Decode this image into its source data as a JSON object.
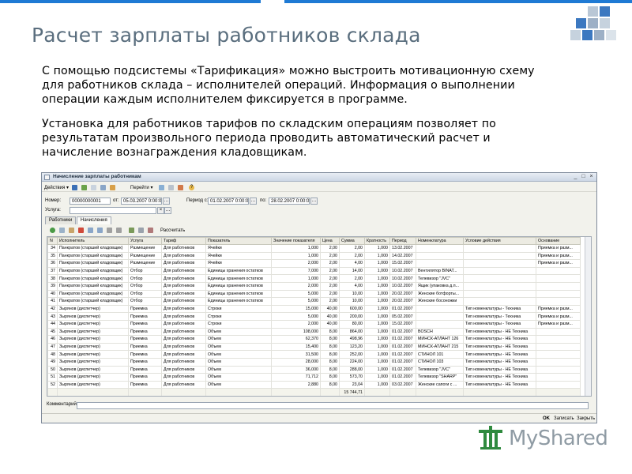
{
  "slide": {
    "title": "Расчет зарплаты работников склада",
    "paragraph1": "С помощью подсистемы «Тарификация» можно выстроить мотивационную схему для работников склада – исполнителей операций. Информация о выполнении операции каждым исполнителем фиксируется в программе.",
    "paragraph2": "Установка для работников тарифов по складским операциям позволяет по результатам произвольного периода проводить автоматический расчет и начисление вознаграждения кладовщикам."
  },
  "window": {
    "title": "Начисление зарплаты работникам",
    "menu": {
      "actions": "Действия ▾",
      "goto": "Перейти ▾",
      "help_glyph": "?"
    },
    "form": {
      "number_label": "Номер:",
      "number_value": "00000000001",
      "from_label": "от:",
      "from_value": "05.03.2007  0:00:00",
      "period_from_label": "Период с:",
      "period_from_value": "01.02.2007  0:00:00",
      "period_to_label": "по:",
      "period_to_value": "28.02.2007  0:00:00",
      "service_label": "Услуга:",
      "service_value": ""
    },
    "tabs": [
      "Работники",
      "Начисления"
    ],
    "active_tab": 1,
    "grid_toolbar": {
      "calculate_label": "Рассчитать"
    },
    "columns": [
      "N",
      "Исполнитель",
      "Услуга",
      "Тариф",
      "Показатель",
      "Значение показателя",
      "Цена",
      "Сумма",
      "Кратность",
      "Период",
      "Номенклатура",
      "Условие действия",
      "Основание"
    ],
    "rows": [
      [
        "34",
        "Панкратов (старший кладовщик)",
        "Размещение",
        "Для работников",
        "Ячейки",
        "1,000",
        "2,00",
        "2,00",
        "1,000",
        "13.02.2007",
        "",
        "",
        "Приемка и разм..."
      ],
      [
        "35",
        "Панкратов (старший кладовщик)",
        "Размещение",
        "Для работников",
        "Ячейки",
        "1,000",
        "2,00",
        "2,00",
        "1,000",
        "14.02.2007",
        "",
        "",
        "Приемка и разм..."
      ],
      [
        "36",
        "Панкратов (старший кладовщик)",
        "Размещение",
        "Для работников",
        "Ячейки",
        "2,000",
        "2,00",
        "4,00",
        "1,000",
        "15.02.2007",
        "",
        "",
        "Приемка и разм..."
      ],
      [
        "37",
        "Панкратов (старший кладовщик)",
        "Отбор",
        "Для работников",
        "Единицы хранения остатков",
        "7,000",
        "2,00",
        "14,00",
        "1,000",
        "10.02.2007",
        "Вентилятор BINAT...",
        "",
        ""
      ],
      [
        "38",
        "Панкратов (старший кладовщик)",
        "Отбор",
        "Для работников",
        "Единицы хранения остатков",
        "1,000",
        "2,00",
        "2,00",
        "1,000",
        "10.02.2007",
        "Телевизор \"JVC\"",
        "",
        ""
      ],
      [
        "39",
        "Панкратов (старший кладовщик)",
        "Отбор",
        "Для работников",
        "Единицы хранения остатков",
        "2,000",
        "2,00",
        "4,00",
        "1,000",
        "10.02.2007",
        "Ящик (упаковка д.п...",
        "",
        ""
      ],
      [
        "40",
        "Панкратов (старший кладовщик)",
        "Отбор",
        "Для работников",
        "Единицы хранения остатков",
        "5,000",
        "2,00",
        "10,00",
        "1,000",
        "20.02.2007",
        "Женские ботфорты...",
        "",
        ""
      ],
      [
        "41",
        "Панкратов (старший кладовщик)",
        "Отбор",
        "Для работников",
        "Единицы хранения остатков",
        "5,000",
        "2,00",
        "10,00",
        "1,000",
        "20.02.2007",
        "Женские босоножки",
        "",
        ""
      ],
      [
        "42",
        "Зырянов (диспетчер)",
        "Приемка",
        "Для работников",
        "Строки",
        "15,000",
        "40,00",
        "600,00",
        "1,000",
        "01.02.2007",
        "",
        "Тип номенклатуры - Техника",
        "Приемка и разм..."
      ],
      [
        "43",
        "Зырянов (диспетчер)",
        "Приемка",
        "Для работников",
        "Строки",
        "5,000",
        "40,00",
        "200,00",
        "1,000",
        "05.02.2007",
        "",
        "Тип номенклатуры - Техника",
        "Приемка и разм..."
      ],
      [
        "44",
        "Зырянов (диспетчер)",
        "Приемка",
        "Для работников",
        "Строки",
        "2,000",
        "40,00",
        "80,00",
        "1,000",
        "15.02.2007",
        "",
        "Тип номенклатуры - Техника",
        "Приемка и разм..."
      ],
      [
        "45",
        "Зырянов (диспетчер)",
        "Приемка",
        "Для работников",
        "Объем",
        "108,000",
        "8,00",
        "864,00",
        "1,000",
        "01.02.2007",
        "BOSCH",
        "Тип номенклатуры - НЕ Техника",
        ""
      ],
      [
        "46",
        "Зырянов (диспетчер)",
        "Приемка",
        "Для работников",
        "Объем",
        "62,370",
        "8,00",
        "498,96",
        "1,000",
        "01.02.2007",
        "МИНСК-АТЛАНТ 126",
        "Тип номенклатуры - НЕ Техника",
        ""
      ],
      [
        "47",
        "Зырянов (диспетчер)",
        "Приемка",
        "Для работников",
        "Объем",
        "15,400",
        "8,00",
        "123,20",
        "1,000",
        "01.02.2007",
        "МИНСК-АТЛАНТ 215",
        "Тип номенклатуры - НЕ Техника",
        ""
      ],
      [
        "48",
        "Зырянов (диспетчер)",
        "Приемка",
        "Для работников",
        "Объем",
        "31,500",
        "8,00",
        "252,00",
        "1,000",
        "01.02.2007",
        "СТИНОЛ 101",
        "Тип номенклатуры - НЕ Техника",
        ""
      ],
      [
        "49",
        "Зырянов (диспетчер)",
        "Приемка",
        "Для работников",
        "Объем",
        "28,000",
        "8,00",
        "224,00",
        "1,000",
        "01.02.2007",
        "СТИНОЛ 103",
        "Тип номенклатуры - НЕ Техника",
        ""
      ],
      [
        "50",
        "Зырянов (диспетчер)",
        "Приемка",
        "Для работников",
        "Объем",
        "36,000",
        "8,00",
        "288,00",
        "1,000",
        "01.02.2007",
        "Телевизор \"JVC\"",
        "Тип номенклатуры - НЕ Техника",
        ""
      ],
      [
        "51",
        "Зырянов (диспетчер)",
        "Приемка",
        "Для работников",
        "Объем",
        "71,712",
        "8,00",
        "573,70",
        "1,000",
        "01.02.2007",
        "Телевизор \"SHARP\"",
        "Тип номенклатуры - НЕ Техника",
        ""
      ],
      [
        "52",
        "Зырянов (диспетчер)",
        "Приемка",
        "Для работников",
        "Объем",
        "2,880",
        "8,00",
        "23,04",
        "1,000",
        "03.02.2007",
        "Женские сапоги с ...",
        "Тип номенклатуры - НЕ Техника",
        ""
      ]
    ],
    "total": "15 744,71",
    "comment_label": "Комментарий:",
    "bottom": {
      "ok": "OK",
      "save": "Записать",
      "close": "Закрыть"
    }
  },
  "brand": {
    "name": "MyShared"
  },
  "colors": {
    "accent": "#1f7ad4",
    "title": "#5a6e7e",
    "brand_green": "#2f8a3e"
  }
}
